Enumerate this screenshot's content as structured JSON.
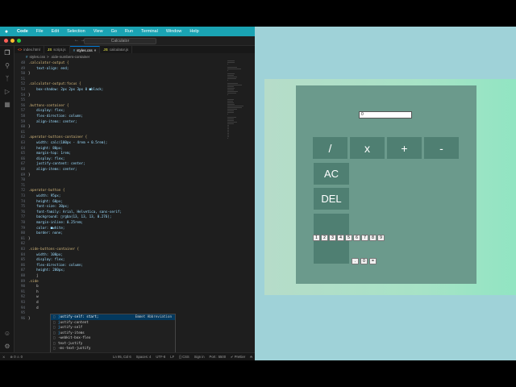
{
  "menubar": {
    "apple": "",
    "items": [
      "Code",
      "File",
      "Edit",
      "Selection",
      "View",
      "Go",
      "Run",
      "Terminal",
      "Window",
      "Help"
    ]
  },
  "window": {
    "title": "Calculator",
    "nav": "←  →"
  },
  "tabs": [
    {
      "icon": "<>",
      "label": "index.html",
      "active": false
    },
    {
      "icon": "JS",
      "label": "script.js",
      "active": false
    },
    {
      "icon": "#",
      "label": "styles.css",
      "active": true,
      "close": "×"
    },
    {
      "icon": "JS",
      "label": "calculator.js",
      "active": false
    }
  ],
  "breadcrumb": {
    "file": "styles.css",
    "sep": ">",
    "symbol": ".side-numbers-container"
  },
  "code_lines": [
    {
      "n": "48",
      "t": ".calculator-output {"
    },
    {
      "n": "49",
      "t": "    text-align: end;"
    },
    {
      "n": "50",
      "t": "}"
    },
    {
      "n": "51",
      "t": ""
    },
    {
      "n": "52",
      "t": ".calculator-output:focus {"
    },
    {
      "n": "53",
      "t": "    box-shadow: 2px 2px 3px 0 ■black;"
    },
    {
      "n": "54",
      "t": "}"
    },
    {
      "n": "55",
      "t": ""
    },
    {
      "n": "56",
      "t": ".buttons-container {"
    },
    {
      "n": "57",
      "t": "    display: flex;"
    },
    {
      "n": "58",
      "t": "    flex-direction: column;"
    },
    {
      "n": "59",
      "t": "    align-items: center;"
    },
    {
      "n": "60",
      "t": "}"
    },
    {
      "n": "61",
      "t": ""
    },
    {
      "n": "62",
      "t": ".operator-buttons-container {"
    },
    {
      "n": "63",
      "t": "    width: calc(100px - 4rem + 0.5rem);"
    },
    {
      "n": "64",
      "t": "    height: 80px;"
    },
    {
      "n": "65",
      "t": "    margin-top: 1rem;"
    },
    {
      "n": "66",
      "t": "    display: flex;"
    },
    {
      "n": "67",
      "t": "    justify-content: center;"
    },
    {
      "n": "68",
      "t": "    align-items: center;"
    },
    {
      "n": "69",
      "t": "}"
    },
    {
      "n": "70",
      "t": ""
    },
    {
      "n": "71",
      "t": ""
    },
    {
      "n": "72",
      "t": ".operator-button {"
    },
    {
      "n": "73",
      "t": "    width: 95px;"
    },
    {
      "n": "74",
      "t": "    height: 60px;"
    },
    {
      "n": "75",
      "t": "    font-size: 30px;"
    },
    {
      "n": "76",
      "t": "    font-family: Arial, Helvetica, sans-serif;"
    },
    {
      "n": "77",
      "t": "    background: □rgba(13, 13, 13, 0.276);"
    },
    {
      "n": "78",
      "t": "    margin-inline: 0.25rem;"
    },
    {
      "n": "79",
      "t": "    color: ■white;"
    },
    {
      "n": "80",
      "t": "    border: none;"
    },
    {
      "n": "81",
      "t": "}"
    },
    {
      "n": "82",
      "t": ""
    },
    {
      "n": "83",
      "t": ".side-buttons-container {"
    },
    {
      "n": "84",
      "t": "    width: 100px;"
    },
    {
      "n": "85",
      "t": "    display: flex;"
    },
    {
      "n": "86",
      "t": "    flex-direction: column;"
    },
    {
      "n": "87",
      "t": "    height: 280px;"
    },
    {
      "n": "88",
      "t": "    j"
    },
    {
      "n": "89",
      "t": ".side"
    },
    {
      "n": "90",
      "t": "    b"
    },
    {
      "n": "91",
      "t": "    h"
    },
    {
      "n": "92",
      "t": "    w"
    },
    {
      "n": "93",
      "t": "    d"
    },
    {
      "n": "94",
      "t": "    d"
    },
    {
      "n": "95",
      "t": "    "
    },
    {
      "n": "96",
      "t": "}"
    }
  ],
  "suggestions": [
    {
      "prefix": "",
      "hl": "j",
      "rest": "ustify-self: start;",
      "detail": "Emmet Abbreviation",
      "selected": true
    },
    {
      "prefix": "",
      "hl": "j",
      "rest": "ustify-content",
      "detail": "",
      "selected": false
    },
    {
      "prefix": "",
      "hl": "j",
      "rest": "ustify-self",
      "detail": "",
      "selected": false
    },
    {
      "prefix": "",
      "hl": "j",
      "rest": "ustify-items",
      "detail": "",
      "selected": false
    },
    {
      "prefix": "-webkit-",
      "hl": "",
      "rest": "box-flex",
      "detail": "",
      "selected": false
    },
    {
      "prefix": "",
      "hl": "",
      "rest": "text-justify",
      "detail": "",
      "selected": false
    },
    {
      "prefix": "",
      "hl": "",
      "rest": "-ms-text-justify",
      "detail": "",
      "selected": false
    }
  ],
  "status": {
    "remote": "⨯",
    "problems": "⊗ 0 ⚠ 0",
    "position": "Ln 95, Col 6",
    "spaces": "Spaces: 4",
    "encoding": "UTF-8",
    "eol": "LF",
    "language": "{} CSS",
    "signin": "Sign in",
    "port": "Port : 5500",
    "prettier": "✔ Prettier",
    "bell": "⍾"
  },
  "calculator": {
    "output_value": "0",
    "operators": [
      "/",
      "x",
      "+",
      "-"
    ],
    "ac_label": "AC",
    "del_label": "DEL",
    "digits": [
      "1",
      "2",
      "3",
      "4",
      "5",
      "6",
      "7",
      "8",
      "9"
    ],
    "dot_label": ".",
    "zero_label": "0",
    "equals_label": "="
  },
  "colors": {
    "menubar": "#1aa3b3",
    "calculator_bg": "#6b9a8c",
    "button_bg": "#4f7f72",
    "preview_bg": "#9fd2d8"
  }
}
